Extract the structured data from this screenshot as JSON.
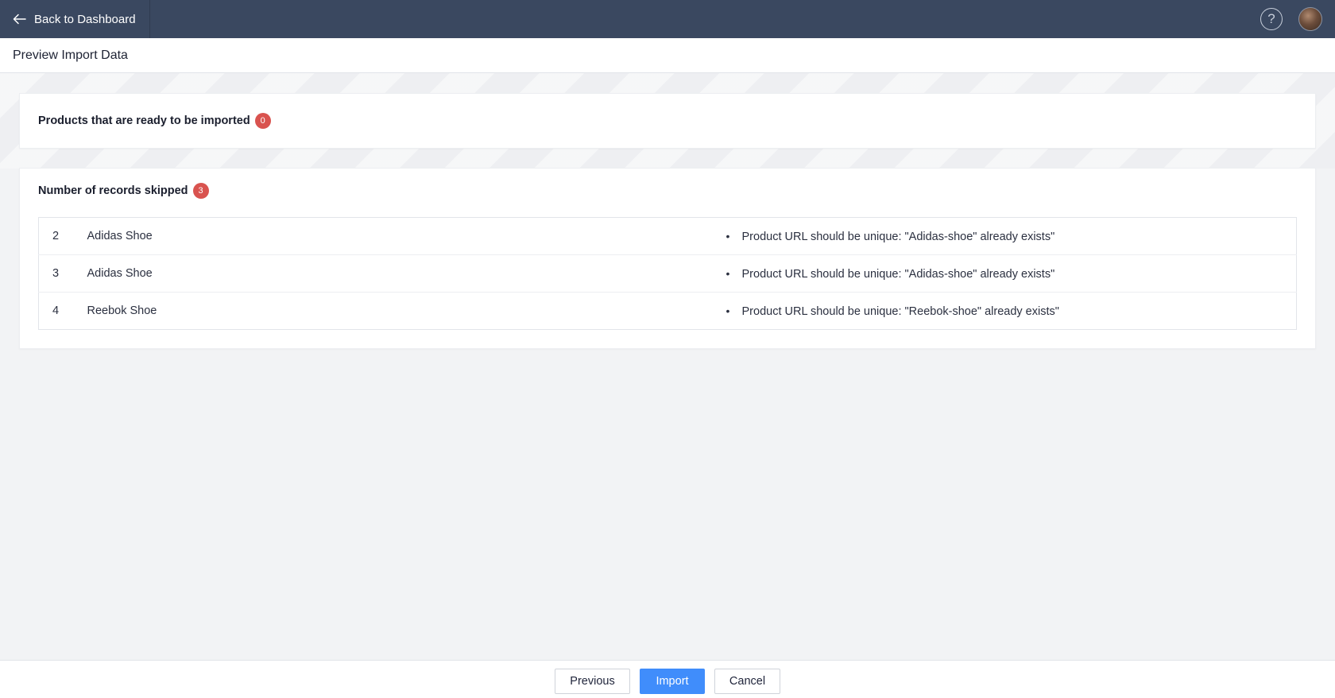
{
  "topbar": {
    "back_label": "Back to Dashboard",
    "help_glyph": "?",
    "icons": {
      "back": "arrow-left-icon",
      "help": "question-circle-icon",
      "avatar": "user-avatar"
    }
  },
  "page": {
    "title": "Preview Import Data"
  },
  "ready": {
    "label": "Products that are ready to be imported",
    "count": "0"
  },
  "skipped": {
    "label": "Number of records skipped",
    "count": "3",
    "rows": [
      {
        "row": "2",
        "name": "Adidas Shoe",
        "error": "Product URL should be unique: \"Adidas-shoe\" already exists\""
      },
      {
        "row": "3",
        "name": "Adidas Shoe",
        "error": "Product URL should be unique: \"Adidas-shoe\" already exists\""
      },
      {
        "row": "4",
        "name": "Reebok Shoe",
        "error": "Product URL should be unique: \"Reebok-shoe\" already exists\""
      }
    ]
  },
  "footer": {
    "previous_label": "Previous",
    "import_label": "Import",
    "cancel_label": "Cancel"
  },
  "colors": {
    "topbar": "#3a4860",
    "badge": "#d9534f",
    "primary": "#408dfb",
    "background": "#f2f3f5"
  }
}
